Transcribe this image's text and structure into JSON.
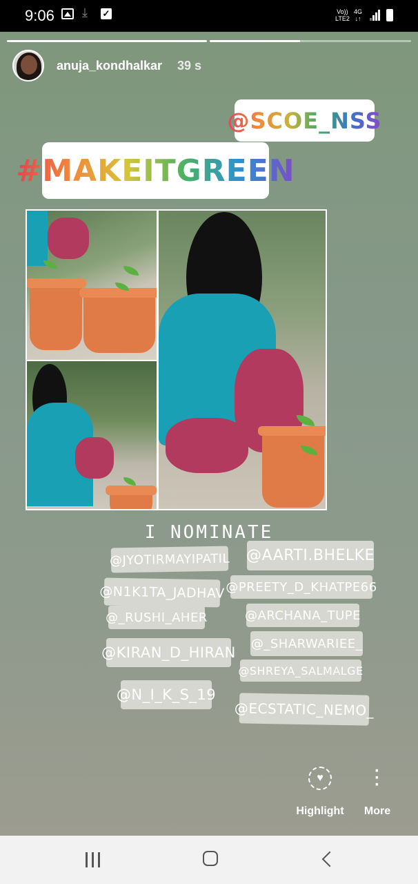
{
  "status_bar": {
    "time": "9:06",
    "network_top": "Vo))",
    "network_bottom": "LTE2",
    "data_top": "4G",
    "data_bottom": "↓↑",
    "icons": [
      "gallery-icon",
      "download-icon",
      "check-icon",
      "signal-icon",
      "battery-icon"
    ]
  },
  "story": {
    "progress": [
      1.0,
      0.45
    ],
    "username": "anuja_kondhalkar",
    "time_ago": "39 s",
    "stickers": {
      "mention_main": "@SCOE_NSS",
      "hashtag": "#MAKEITGREEN"
    },
    "nominate_heading": "I NOMINATE",
    "nominees": [
      "@JYOTIRMAYIPATIL",
      "@AARTI.BHELKE",
      "@N1K1TA_JADHAV",
      "@PREETY_D_KHATPE66",
      "@_RUSHI_AHER",
      "@ARCHANA_TUPE",
      "@KIRAN_D_HIRAN",
      "@_SHARWARIEE_",
      "@SHREYA_SALMALGE",
      "@N_I_K_S_19",
      "@ECSTATIC_NEMO_"
    ],
    "actions": {
      "highlight_label": "Highlight",
      "more_label": "More"
    }
  },
  "colors": {
    "story_bg_top": "#7f977c",
    "story_bg_bottom": "#9c9c90",
    "nav_bg": "#f2f2f2"
  }
}
